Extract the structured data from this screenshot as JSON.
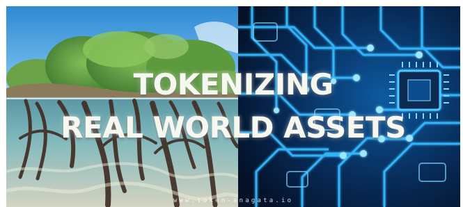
{
  "headline": {
    "line1": "TOKENIZING",
    "line2": "REAL WORLD ASSETS"
  },
  "watermark": "www.token-anagata.io",
  "colors": {
    "text": "#f6f7ef",
    "sky": "#4f9fd8",
    "water": "#74b8c2",
    "foliage": "#5f9a42",
    "circuit_glow": "#38b8ff",
    "circuit_bg": "#071a36"
  },
  "scene": {
    "left_image": "mangrove-underwater-split-view",
    "right_image": "blue-circuit-board-with-chip"
  }
}
